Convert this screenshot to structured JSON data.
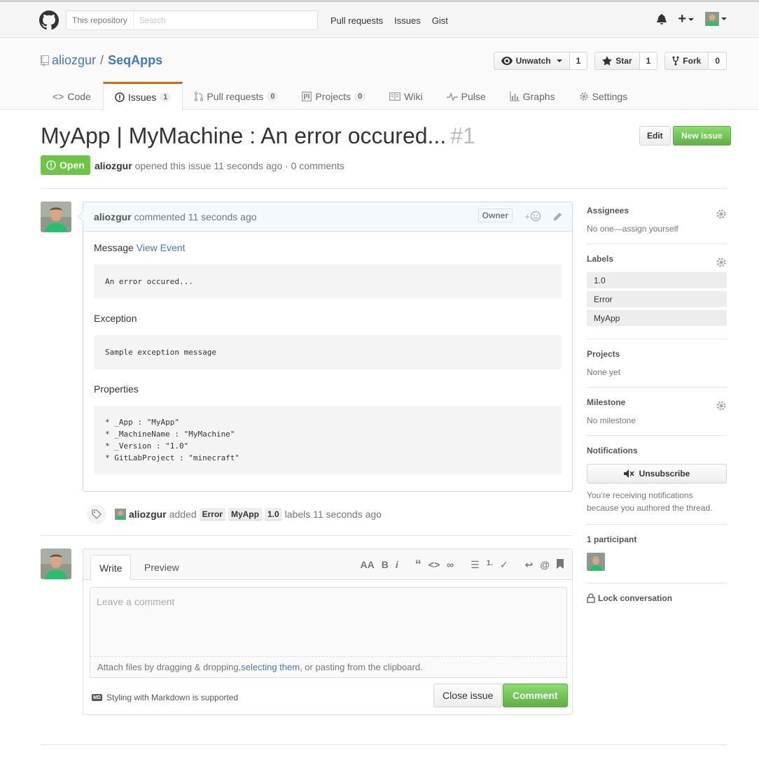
{
  "topbar": {
    "search_scope": "This repository",
    "search_placeholder": "Search",
    "nav": [
      "Pull requests",
      "Issues",
      "Gist"
    ]
  },
  "repo": {
    "owner": "aliozgur",
    "separator": "/",
    "name": "SeqApps",
    "watch_label": "Unwatch",
    "watch_count": "1",
    "star_label": "Star",
    "star_count": "1",
    "fork_label": "Fork",
    "fork_count": "0"
  },
  "tabs": {
    "code": "Code",
    "issues": "Issues",
    "issues_count": "1",
    "pulls": "Pull requests",
    "pulls_count": "0",
    "projects": "Projects",
    "projects_count": "0",
    "wiki": "Wiki",
    "pulse": "Pulse",
    "graphs": "Graphs",
    "settings": "Settings"
  },
  "issue": {
    "title": "MyApp | MyMachine : An error occured...",
    "number": "#1",
    "edit_label": "Edit",
    "new_issue_label": "New issue",
    "state": "Open",
    "author": "aliozgur",
    "meta_text": "opened this issue 11 seconds ago · 0 comments"
  },
  "comment": {
    "author": "aliozgur",
    "time_text": "commented 11 seconds ago",
    "badge": "Owner",
    "reaction": "+",
    "message_label": "Message",
    "view_event_link": "View Event",
    "message_code": "An error occured...",
    "exception_label": "Exception",
    "exception_code": "Sample exception message",
    "properties_label": "Properties",
    "properties_code": "* _App : \"MyApp\"\n* _MachineName : \"MyMachine\"\n* _Version : \"1.0\"\n* GitLabProject : \"minecraft\""
  },
  "event": {
    "actor": "aliozgur",
    "action": "added",
    "labels": [
      "Error",
      "MyApp",
      "1.0"
    ],
    "suffix": "labels 11 seconds ago"
  },
  "form": {
    "write_tab": "Write",
    "preview_tab": "Preview",
    "toolbar": [
      "AA",
      "B",
      "i",
      "“",
      "<>",
      "∞",
      "☰",
      "1.",
      "✓",
      "↩",
      "@",
      "🔖"
    ],
    "placeholder": "Leave a comment",
    "drop_text_before": "Attach files by dragging & dropping, ",
    "drop_link": "selecting them",
    "drop_text_after": ", or pasting from the clipboard.",
    "markdown_note": "Styling with Markdown is supported",
    "md_badge": "MD",
    "close_label": "Close issue",
    "comment_label": "Comment"
  },
  "sidebar": {
    "assignees_head": "Assignees",
    "assignees_text": "No one—assign yourself",
    "labels_head": "Labels",
    "labels": [
      "1.0",
      "Error",
      "MyApp"
    ],
    "projects_head": "Projects",
    "projects_text": "None yet",
    "milestone_head": "Milestone",
    "milestone_text": "No milestone",
    "notifications_head": "Notifications",
    "unsubscribe_label": "Unsubscribe",
    "notify_reason": "You’re receiving notifications because you authored the thread.",
    "participants_head": "1 participant",
    "lock_label": "Lock conversation"
  },
  "colors": {
    "accent_link": "#4078c0",
    "open_green": "#6cc644",
    "tab_active": "#d26911"
  }
}
